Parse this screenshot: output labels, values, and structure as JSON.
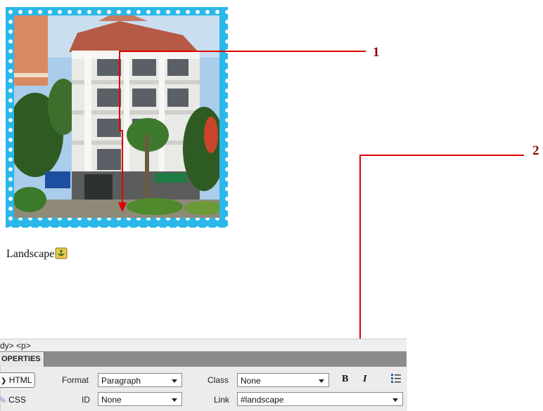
{
  "caption": {
    "text": "Landscape"
  },
  "callouts": [
    {
      "number": "1"
    },
    {
      "number": "2"
    }
  ],
  "panel": {
    "tag_selector": "dy> <p>",
    "tab_label": "OPERTIES",
    "html_button": "HTML",
    "css_button": "CSS",
    "format_label": "Format",
    "format_value": "Paragraph",
    "class_label": "Class",
    "class_value": "None",
    "id_label": "ID",
    "id_value": "None",
    "link_label": "Link",
    "link_value": "#landscape",
    "bold_label": "B",
    "italic_label": "I"
  },
  "colors": {
    "frame": "#2ab7ea",
    "callout": "#8b0000",
    "arrow": "#e00000"
  }
}
